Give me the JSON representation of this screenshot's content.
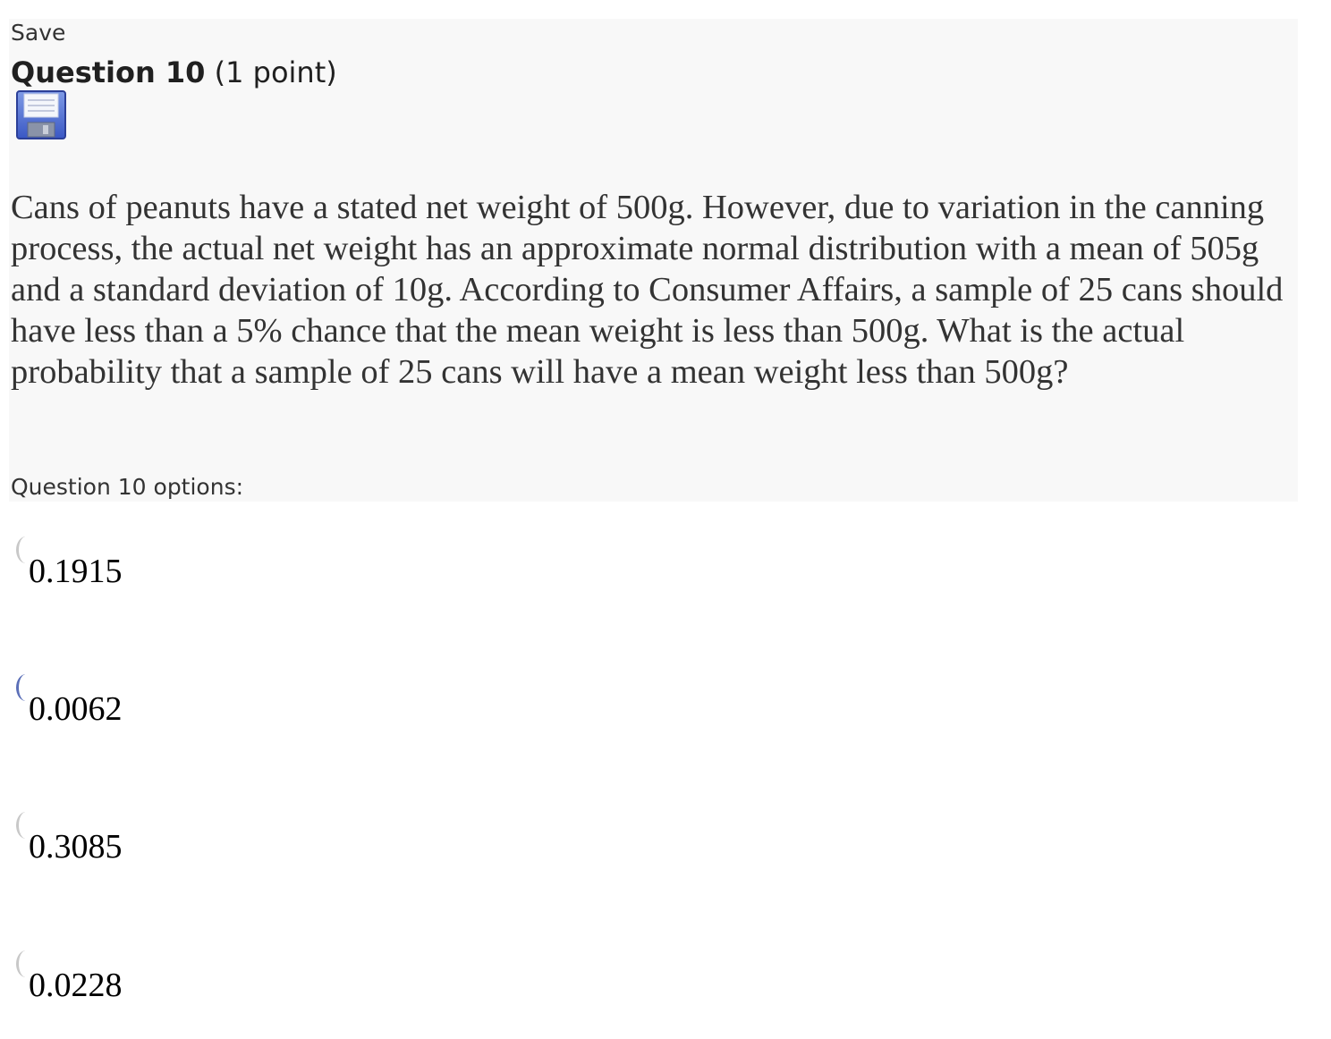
{
  "header": {
    "save_label": "Save",
    "question_title": "Question 10",
    "points": "(1 point)",
    "save_icon": "floppy-disk-icon"
  },
  "question": {
    "text": "Cans of peanuts have a stated net weight of 500g. However, due to variation in the canning process, the actual net weight has an approximate normal distribution with a mean of 505g and a standard deviation of 10g. According to Consumer Affairs, a sample of 25 cans should have less than a 5% chance that the mean weight is less than 500g. What is the actual probability that a sample of 25 cans will have a mean weight less than 500g?",
    "options_label": "Question 10 options:"
  },
  "options": [
    {
      "label": "0.1915"
    },
    {
      "label": "0.0062"
    },
    {
      "label": "0.3085"
    },
    {
      "label": "0.0228"
    }
  ],
  "colors": {
    "panel_background": "#f8f8f8",
    "radio_focus": "#5b6fb8",
    "radio_default": "#c8c8c8"
  }
}
